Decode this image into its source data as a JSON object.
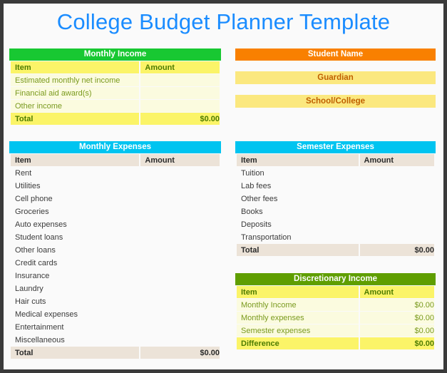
{
  "page": {
    "title": "College Budget Planner Template",
    "title_color": "#1a8cff",
    "background": "#fafafa",
    "border_color": "#3a3a3a"
  },
  "colors": {
    "income_header": "#18c832",
    "expenses_header": "#00c4f0",
    "student_header": "#f98000",
    "discretionary_header": "#5f9e00",
    "yellow_header_row": "#fbf468",
    "yellow_body_row": "#fbfbdf",
    "beige_header_row": "#ece3d8",
    "info_bar": "#fbe87f",
    "info_text": "#c06000"
  },
  "monthly_income": {
    "title": "Monthly Income",
    "columns": [
      "Item",
      "Amount"
    ],
    "rows": [
      {
        "item": "Estimated monthly net income",
        "amount": ""
      },
      {
        "item": "Financial aid award(s)",
        "amount": ""
      },
      {
        "item": "Other income",
        "amount": ""
      }
    ],
    "total_label": "Total",
    "total_amount": "$0.00"
  },
  "student_info": {
    "title": "Student Name",
    "fields": [
      {
        "label": "Guardian"
      },
      {
        "label": "School/College"
      }
    ]
  },
  "monthly_expenses": {
    "title": "Monthly Expenses",
    "columns": [
      "Item",
      "Amount"
    ],
    "rows": [
      {
        "item": "Rent",
        "amount": ""
      },
      {
        "item": "Utilities",
        "amount": ""
      },
      {
        "item": "Cell phone",
        "amount": ""
      },
      {
        "item": "Groceries",
        "amount": ""
      },
      {
        "item": "Auto expenses",
        "amount": ""
      },
      {
        "item": "Student loans",
        "amount": ""
      },
      {
        "item": "Other loans",
        "amount": ""
      },
      {
        "item": "Credit cards",
        "amount": ""
      },
      {
        "item": "Insurance",
        "amount": ""
      },
      {
        "item": "Laundry",
        "amount": ""
      },
      {
        "item": "Hair cuts",
        "amount": ""
      },
      {
        "item": "Medical expenses",
        "amount": ""
      },
      {
        "item": "Entertainment",
        "amount": ""
      },
      {
        "item": "Miscellaneous",
        "amount": ""
      }
    ],
    "total_label": "Total",
    "total_amount": "$0.00"
  },
  "semester_expenses": {
    "title": "Semester Expenses",
    "columns": [
      "Item",
      "Amount"
    ],
    "rows": [
      {
        "item": "Tuition",
        "amount": ""
      },
      {
        "item": "Lab fees",
        "amount": ""
      },
      {
        "item": "Other fees",
        "amount": ""
      },
      {
        "item": "Books",
        "amount": ""
      },
      {
        "item": "Deposits",
        "amount": ""
      },
      {
        "item": "Transportation",
        "amount": ""
      }
    ],
    "total_label": "Total",
    "total_amount": "$0.00"
  },
  "discretionary_income": {
    "title": "Discretionary Income",
    "columns": [
      "Item",
      "Amount"
    ],
    "rows": [
      {
        "item": "Monthly Income",
        "amount": "$0.00"
      },
      {
        "item": "Monthly expenses",
        "amount": "$0.00"
      },
      {
        "item": "Semester expenses",
        "amount": "$0.00"
      }
    ],
    "total_label": "Difference",
    "total_amount": "$0.00"
  }
}
